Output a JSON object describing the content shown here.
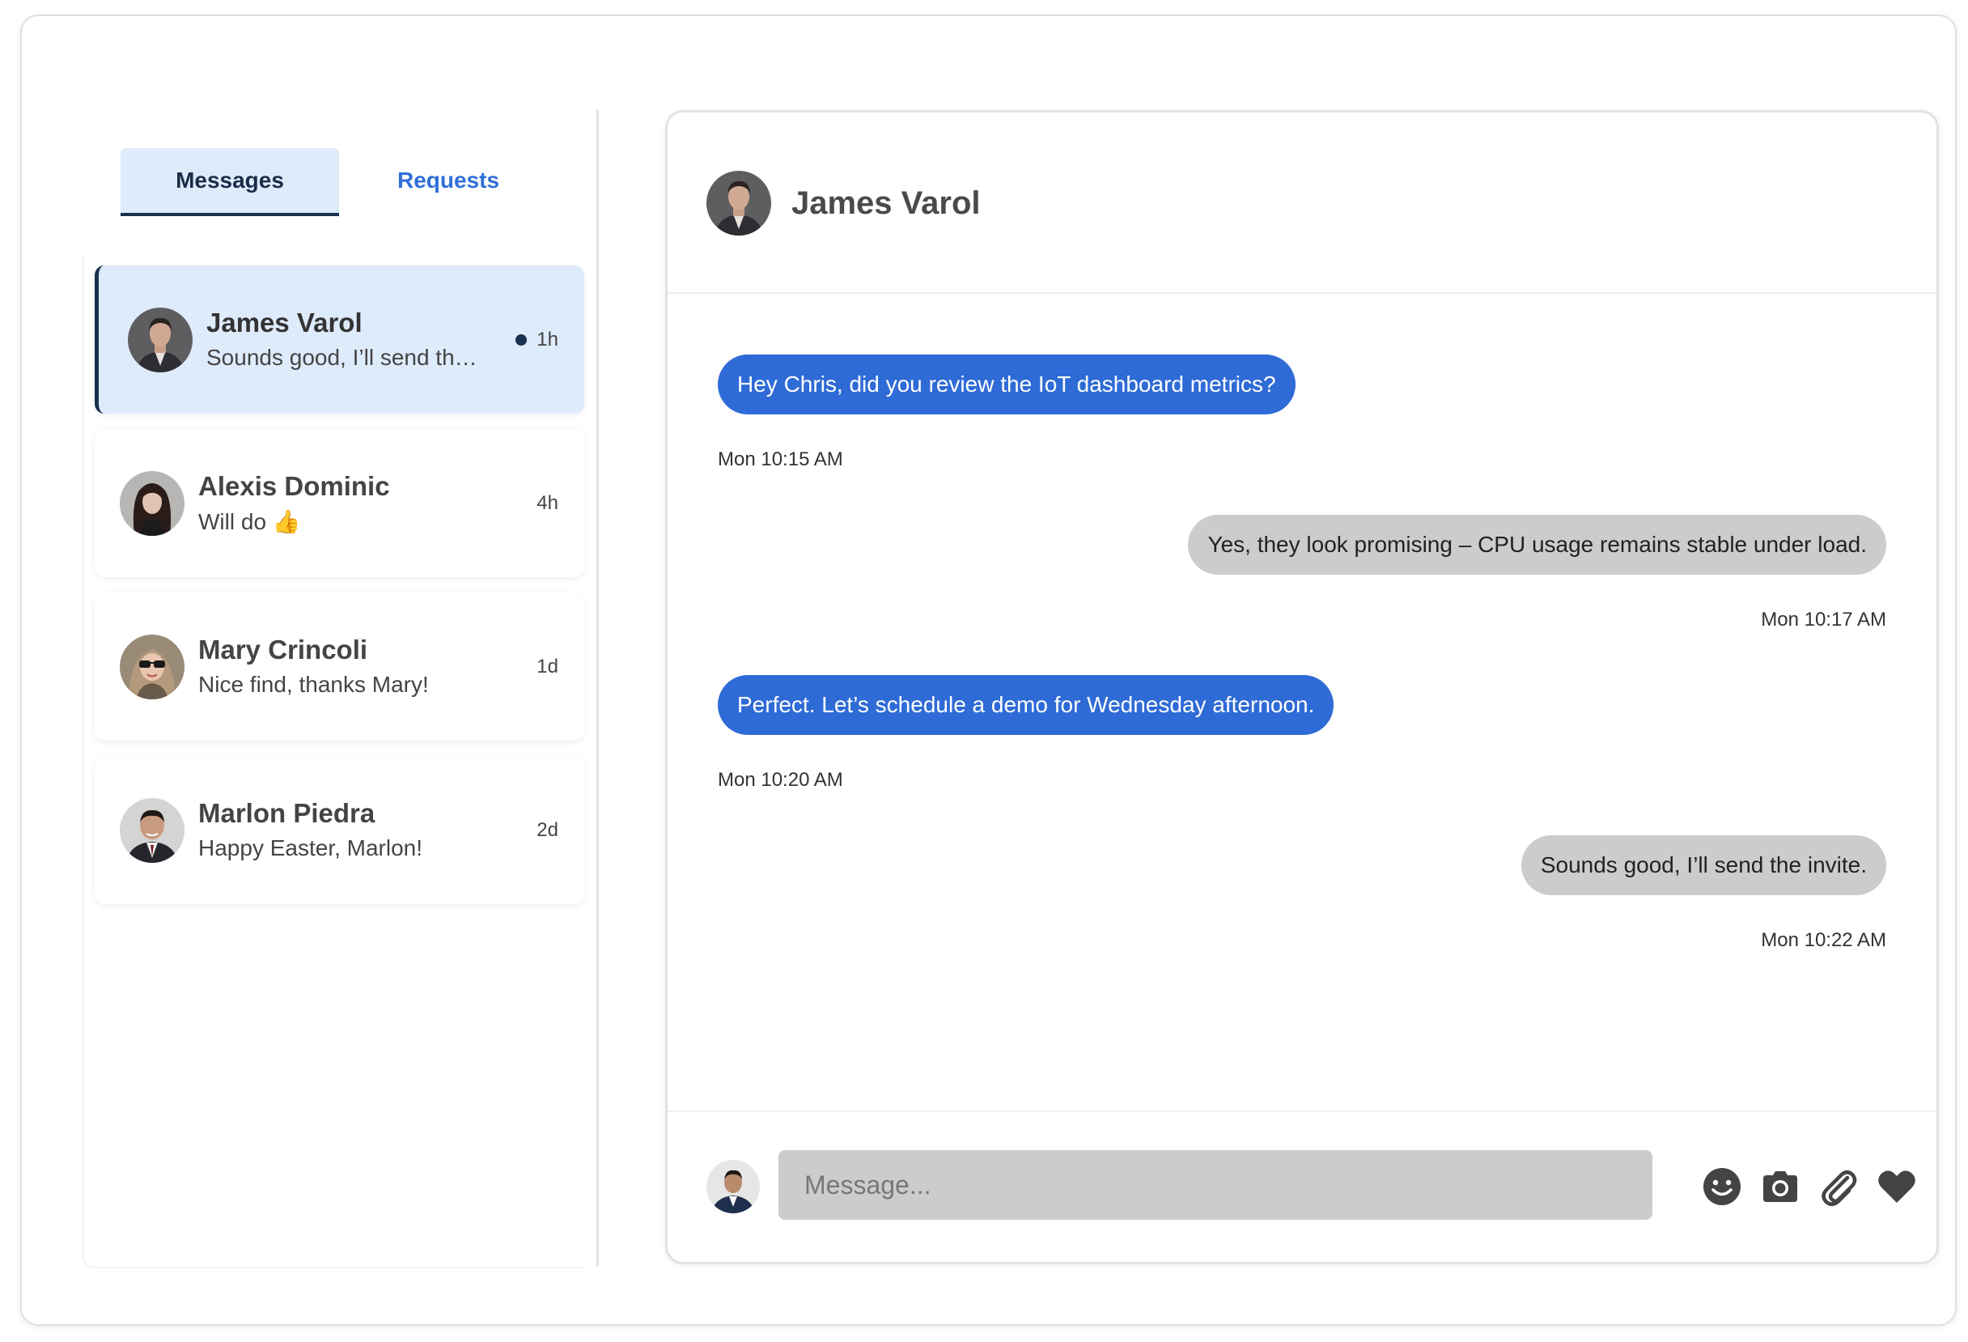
{
  "tabs": {
    "messages": "Messages",
    "requests": "Requests"
  },
  "conversations": [
    {
      "name": "James Varol",
      "preview": "Sounds good, I’ll send the invite.",
      "time": "1h",
      "unread": true
    },
    {
      "name": "Alexis Dominic",
      "preview": "Will do 👍",
      "time": "4h",
      "unread": false
    },
    {
      "name": "Mary Crincoli",
      "preview": "Nice find, thanks Mary!",
      "time": "1d",
      "unread": false
    },
    {
      "name": "Marlon Piedra",
      "preview": "Happy Easter, Marlon!",
      "time": "2d",
      "unread": false
    }
  ],
  "chat": {
    "title": "James Varol",
    "messages": [
      {
        "direction": "incoming",
        "text": "Hey Chris, did you review the IoT dashboard metrics?",
        "time": "Mon 10:15 AM"
      },
      {
        "direction": "outgoing",
        "text": "Yes, they look promising – CPU usage remains stable under load.",
        "time": "Mon 10:17 AM"
      },
      {
        "direction": "incoming",
        "text": "Perfect. Let’s schedule a demo for Wednesday afternoon.",
        "time": "Mon 10:20 AM"
      },
      {
        "direction": "outgoing",
        "text": "Sounds good, I’ll send the invite.",
        "time": "Mon 10:22 AM"
      }
    ]
  },
  "composer": {
    "placeholder": "Message...",
    "icons": [
      "smiley-icon",
      "camera-icon",
      "paperclip-icon",
      "heart-icon"
    ]
  },
  "colors": {
    "accent_blue": "#2f6bd6",
    "selected_bg": "#deebfb",
    "dark_navy": "#1b3150",
    "outgoing_bubble": "#cccccc"
  }
}
